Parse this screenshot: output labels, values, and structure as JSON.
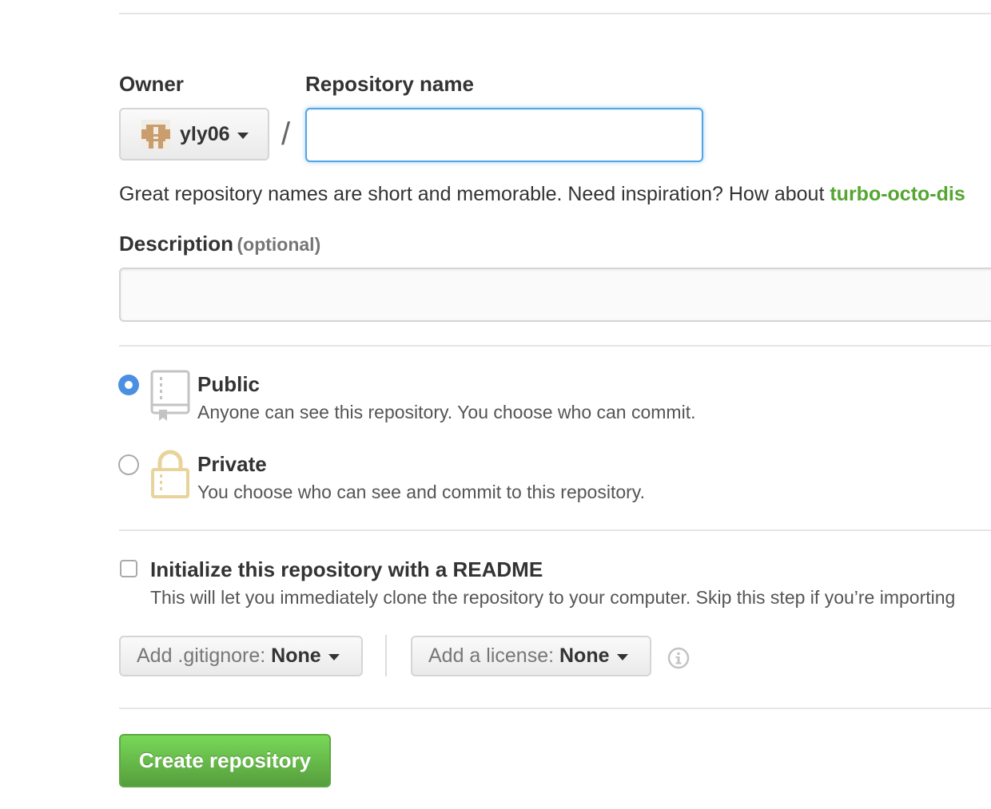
{
  "owner": {
    "label": "Owner",
    "selected": "yly06"
  },
  "repository": {
    "label": "Repository name",
    "value": "",
    "separator": "/",
    "hint_prefix": "Great repository names are short and memorable. Need inspiration? How about ",
    "suggestion": "turbo-octo-dis"
  },
  "description": {
    "label": "Description",
    "optional": "(optional)",
    "value": ""
  },
  "visibility": {
    "selected": "public",
    "options": [
      {
        "id": "public",
        "title": "Public",
        "description": "Anyone can see this repository. You choose who can commit."
      },
      {
        "id": "private",
        "title": "Private",
        "description": "You choose who can see and commit to this repository."
      }
    ]
  },
  "init": {
    "checked": false,
    "title": "Initialize this repository with a README",
    "description": "This will let you immediately clone the repository to your computer. Skip this step if you’re importing"
  },
  "gitignore": {
    "prefix": "Add .gitignore: ",
    "value": "None"
  },
  "license": {
    "prefix": "Add a license: ",
    "value": "None"
  },
  "submit": {
    "label": "Create repository"
  },
  "colors": {
    "accent": "#4a90e2",
    "focus_border": "#51a7e8",
    "suggestion": "#55a532",
    "create_button": "#6cc644",
    "lock_icon": "#e8d49b"
  }
}
